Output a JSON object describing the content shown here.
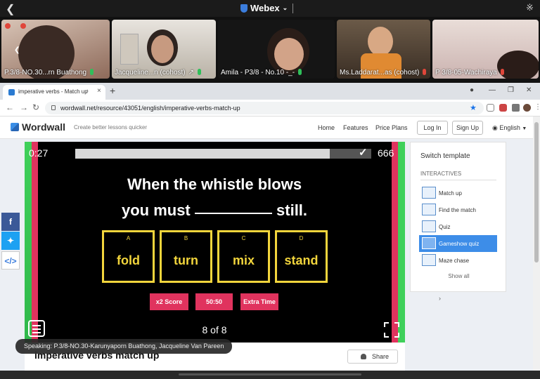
{
  "webex": {
    "app_name": "Webex"
  },
  "participants": [
    {
      "name": "P.3/8-NO.30...rn Buathong",
      "mic": "on"
    },
    {
      "name": "Jacqueline...n (cohost)",
      "mic": "on"
    },
    {
      "name": "Amila - P3/8 - No.10 -_-",
      "mic": "on"
    },
    {
      "name": "Ms.Laddarat...as (cohost)",
      "mic": "off"
    },
    {
      "name": "P 3/8-05-Wachiraya",
      "mic": "off"
    }
  ],
  "browser": {
    "tab_title": "imperative verbs - Match up",
    "url": "wordwall.net/resource/43051/english/imperative-verbs-match-up"
  },
  "wordwall": {
    "logo": "Wordwall",
    "tagline": "Create better lessons quicker",
    "nav": [
      "Home",
      "Features",
      "Price Plans"
    ],
    "login": "Log In",
    "signup": "Sign Up",
    "language": "English"
  },
  "game": {
    "timer": "0:27",
    "score": "666",
    "time_remaining_fraction": 0.86,
    "question_line1": "When the whistle blows",
    "question_pre": "you must",
    "question_post": "still.",
    "answers": [
      {
        "letter": "A",
        "word": "fold"
      },
      {
        "letter": "B",
        "word": "turn"
      },
      {
        "letter": "C",
        "word": "mix"
      },
      {
        "letter": "D",
        "word": "stand"
      }
    ],
    "powerups": [
      "x2 Score",
      "50:50",
      "Extra Time"
    ],
    "counter": "8 of 8"
  },
  "templates": {
    "title": "Switch template",
    "section": "INTERACTIVES",
    "items": [
      {
        "label": "Match up",
        "active": false
      },
      {
        "label": "Find the match",
        "active": false
      },
      {
        "label": "Quiz",
        "active": false
      },
      {
        "label": "Gameshow quiz",
        "active": true
      },
      {
        "label": "Maze chase",
        "active": false
      }
    ],
    "show_all": "Show all"
  },
  "activity": {
    "title": "imperative verbs match up",
    "share": "Share"
  },
  "speaking": "Speaking: P.3/8-NO.30-Karunyaporn Buathong, Jacqueline Van Pareen",
  "colors": {
    "accent": "#3d8de8",
    "game_yellow": "#f2d53c",
    "game_pink": "#e0335e",
    "game_green": "#3fd05a"
  }
}
